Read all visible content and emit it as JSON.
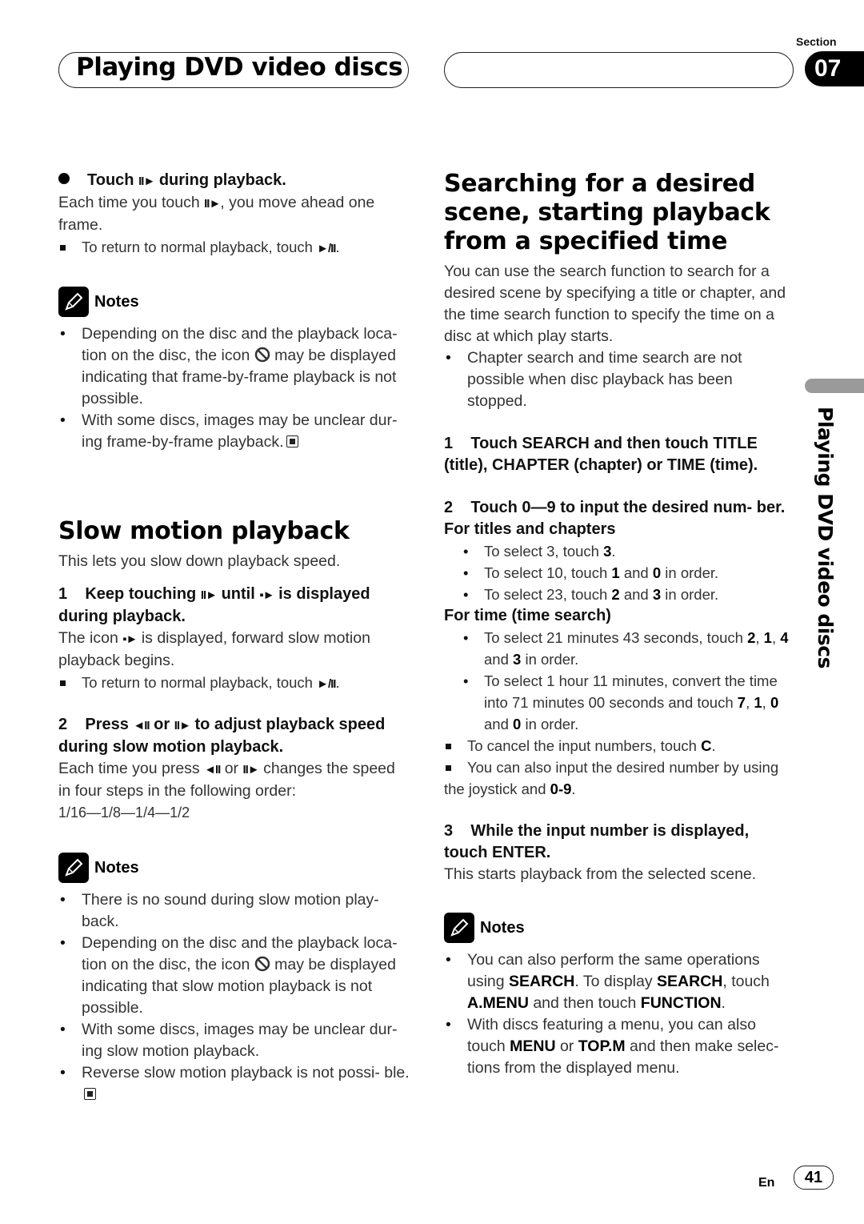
{
  "header": {
    "title": "Playing DVD video discs",
    "section_label": "Section",
    "section_number": "07"
  },
  "side_tab": {
    "label": "Playing DVD video discs"
  },
  "left": {
    "frame_step": {
      "heading_pre": "Touch",
      "heading_glyph": "II►",
      "heading_post": "during playback.",
      "body_pre": "Each time you touch",
      "body_glyph": "II►",
      "body_post": ", you move ahead one frame.",
      "tip_pre": "To return to normal playback, touch",
      "tip_glyph": "►/II",
      "tip_post": "."
    },
    "notes1": {
      "title": "Notes",
      "items": [
        {
          "pre": "Depending on the disc and the playback loca- tion on the disc, the icon",
          "post": "may be displayed indicating that frame-by-frame playback is not possible."
        },
        {
          "text": "With some discs, images may be unclear dur- ing frame-by-frame playback."
        }
      ]
    },
    "slow": {
      "title": "Slow motion playback",
      "intro": "This lets you slow down playback speed.",
      "step1": {
        "num": "1",
        "h_pre": "Keep touching",
        "h_glyph1": "II►",
        "h_mid": "until",
        "h_glyph2": "▪►",
        "h_post": "is displayed during playback.",
        "body_pre": "The icon",
        "body_glyph": "▪►",
        "body_post": "is displayed, forward slow motion playback begins.",
        "tip_pre": "To return to normal playback, touch",
        "tip_glyph": "►/II",
        "tip_post": "."
      },
      "step2": {
        "num": "2",
        "h_pre": "Press",
        "h_glyph1": "◄II",
        "h_mid": "or",
        "h_glyph2": "II►",
        "h_post": "to adjust playback speed during slow motion playback.",
        "body_pre": "Each time you press",
        "body_glyph1": "◄II",
        "body_mid": "or",
        "body_glyph2": "II►",
        "body_post": "changes the speed in four steps in the following order:",
        "order": "1/16—1/8—1/4—1/2"
      }
    },
    "notes2": {
      "title": "Notes",
      "items": [
        {
          "text": "There is no sound during slow motion play- back."
        },
        {
          "pre": "Depending on the disc and the playback loca- tion on the disc, the icon",
          "post": "may be displayed indicating that slow motion playback is not possible."
        },
        {
          "text": "With some discs, images may be unclear dur- ing slow motion playback."
        },
        {
          "text": "Reverse slow motion playback is not possi- ble."
        }
      ]
    }
  },
  "right": {
    "title": "Searching for a desired scene, starting playback from a specified time",
    "intro": "You can use the search function to search for a desired scene by specifying a title or chapter, and the time search function to specify the time on a disc at which play starts.",
    "intro_bullet": "Chapter search and time search are not possible when disc playback has been stopped.",
    "step1": {
      "num": "1",
      "text": "Touch SEARCH and then touch TITLE (title), CHAPTER (chapter) or TIME (time)."
    },
    "step2": {
      "num": "2",
      "text": "Touch 0—9 to input the desired num- ber.",
      "titles_heading": "For titles and chapters",
      "titles_items": [
        {
          "pre": "To select 3, touch ",
          "b1": "3",
          "post": "."
        },
        {
          "pre": "To select 10, touch ",
          "b1": "1",
          "mid": " and ",
          "b2": "0",
          "post": " in order."
        },
        {
          "pre": "To select 23, touch ",
          "b1": "2",
          "mid": " and ",
          "b2": "3",
          "post": " in order."
        }
      ],
      "time_heading": "For time (time search)",
      "time_items": [
        {
          "pre": "To select 21 minutes 43 seconds, touch ",
          "bold_seq": [
            "2",
            "1",
            "4",
            "3"
          ],
          "post": " in order."
        },
        {
          "pre": "To select 1 hour 11 minutes, convert the time into 71 minutes 00 seconds and touch ",
          "bold_seq": [
            "7",
            "1",
            "0",
            "0"
          ],
          "post": " in order."
        }
      ],
      "tip_cancel_pre": "To cancel the input numbers, touch ",
      "tip_cancel_b": "C",
      "tip_cancel_post": ".",
      "tip_joystick_pre": "You can also input the desired number by using the joystick and ",
      "tip_joystick_b": "0-9",
      "tip_joystick_post": "."
    },
    "step3": {
      "num": "3",
      "text": "While the input number is displayed, touch ENTER.",
      "body": "This starts playback from the selected scene."
    },
    "notes": {
      "title": "Notes",
      "item1": {
        "t1": "You can also perform the same operations using ",
        "b1": "SEARCH",
        "t2": ". To display ",
        "b2": "SEARCH",
        "t3": ", touch ",
        "b3": "A.MENU",
        "t4": " and then touch ",
        "b4": "FUNCTION",
        "t5": "."
      },
      "item2": {
        "t1": "With discs featuring a menu, you can also touch ",
        "b1": "MENU",
        "t2": " or ",
        "b2": "TOP.M",
        "t3": " and then make selec- tions from the displayed menu."
      }
    }
  },
  "footer": {
    "lang": "En",
    "page": "41"
  }
}
